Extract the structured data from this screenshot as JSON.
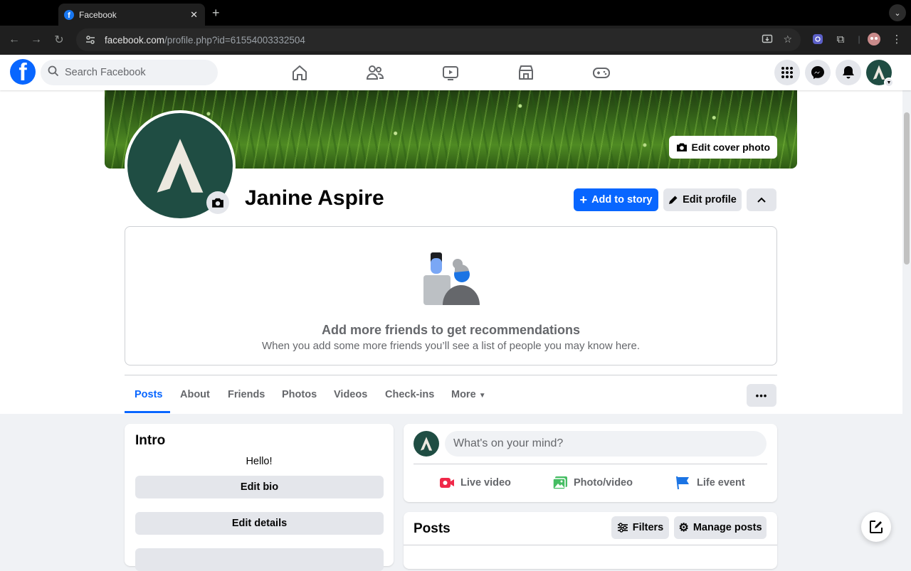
{
  "browser": {
    "tab_title": "Facebook",
    "url_domain": "facebook.com",
    "url_path": "/profile.php?id=61554003332504"
  },
  "header": {
    "search_placeholder": "Search Facebook"
  },
  "profile": {
    "name": "Janine Aspire",
    "edit_cover_label": "Edit cover photo",
    "add_story_label": "Add to story",
    "edit_profile_label": "Edit profile"
  },
  "recommendations": {
    "title": "Add more friends to get recommendations",
    "subtitle": "When you add some more friends you’ll see a list of people you may know here."
  },
  "tabs": [
    {
      "label": "Posts"
    },
    {
      "label": "About"
    },
    {
      "label": "Friends"
    },
    {
      "label": "Photos"
    },
    {
      "label": "Videos"
    },
    {
      "label": "Check-ins"
    },
    {
      "label": "More"
    }
  ],
  "intro": {
    "title": "Intro",
    "bio": "Hello!",
    "edit_bio_label": "Edit bio",
    "edit_details_label": "Edit details"
  },
  "composer": {
    "placeholder": "What's on your mind?",
    "live_video_label": "Live video",
    "photo_video_label": "Photo/video",
    "life_event_label": "Life event"
  },
  "posts": {
    "title": "Posts",
    "filters_label": "Filters",
    "manage_label": "Manage posts"
  },
  "colors": {
    "brand_blue": "#0866ff",
    "avatar_green": "#1f4d43"
  }
}
